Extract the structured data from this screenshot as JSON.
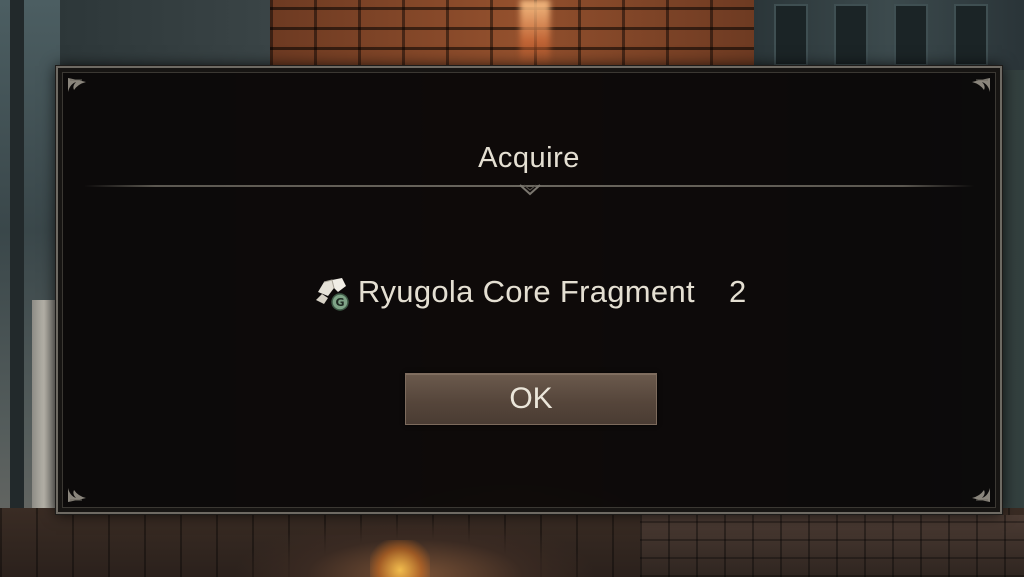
{
  "dialog": {
    "title": "Acquire",
    "reward": {
      "icon": "crystal-fragment-icon",
      "badge": "G",
      "name": "Ryugola Core Fragment",
      "quantity": "2"
    },
    "ok_label": "OK"
  },
  "colors": {
    "text": "#e4dfd2",
    "button": "#56463b",
    "panel": "#0a0807",
    "border": "#6e6a63",
    "badge": "#7fa487"
  }
}
